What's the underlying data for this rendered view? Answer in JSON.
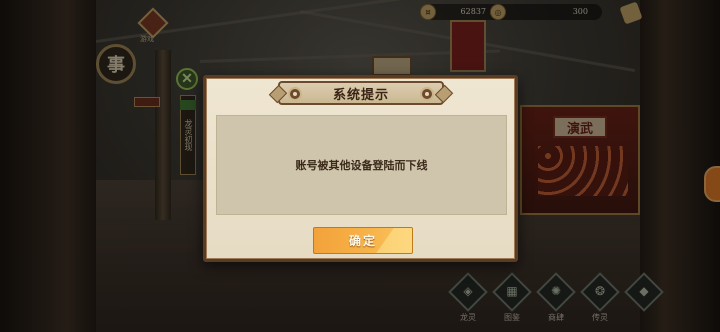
{
  "top_bar": {
    "diamond_label": "游戏",
    "resources": [
      {
        "icon": "coin-icon",
        "value": "62837"
      },
      {
        "icon": "gem-icon",
        "value": "300"
      }
    ]
  },
  "scene": {
    "badge_glyph": "事",
    "banner_text": "龙灵初现",
    "stall_sign": "演武"
  },
  "dialog": {
    "title": "系统提示",
    "message": "账号被其他设备登陆而下线",
    "confirm_label": "确定"
  },
  "bottom_nav": [
    {
      "label": "龙灵",
      "glyph": "◈"
    },
    {
      "label": "图鉴",
      "glyph": "▦"
    },
    {
      "label": "商肆",
      "glyph": "✺"
    },
    {
      "label": "传灵",
      "glyph": "❂"
    },
    {
      "label": "",
      "glyph": "◆"
    }
  ],
  "colors": {
    "dialog_border": "#5a3b24",
    "dialog_bg": "#efe6d2",
    "confirm_button": "#f7b44a",
    "side_tab": "#e87f24"
  }
}
